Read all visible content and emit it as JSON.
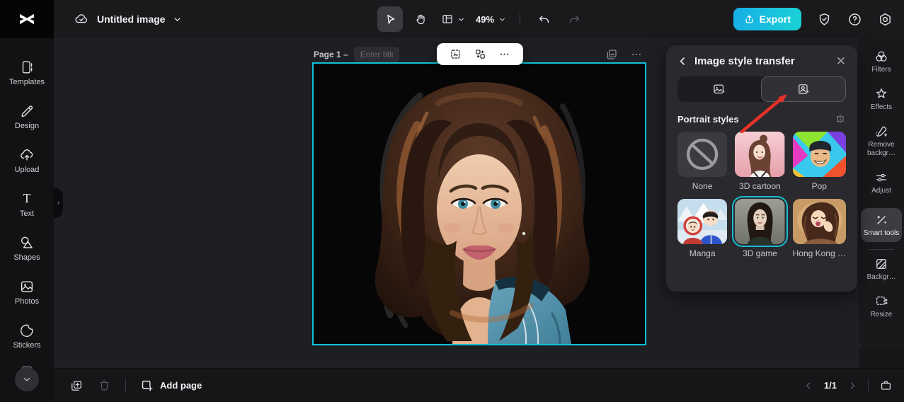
{
  "colors": {
    "accent_cyan": "#10c1d5",
    "export_gradient_from": "#18aee8",
    "export_gradient_to": "#1ad2d4",
    "selection_border": "#17c0d4",
    "annotation_arrow": "#e63229",
    "panel_bg": "#29292e",
    "topbar_bg": "#1a1a1d"
  },
  "topbar": {
    "title": "Untitled image",
    "zoom_level": "49%",
    "export_label": "Export"
  },
  "sidebar": {
    "items": [
      {
        "label": "Templates"
      },
      {
        "label": "Design"
      },
      {
        "label": "Upload"
      },
      {
        "label": "Text"
      },
      {
        "label": "Shapes"
      },
      {
        "label": "Photos"
      },
      {
        "label": "Stickers"
      }
    ]
  },
  "canvas": {
    "page_label": "Page 1 –",
    "title_placeholder": "Enter title"
  },
  "style_panel": {
    "title": "Image style transfer",
    "section_title": "Portrait styles",
    "styles": [
      {
        "label": "None",
        "selected": false
      },
      {
        "label": "3D cartoon",
        "selected": false
      },
      {
        "label": "Pop",
        "selected": false
      },
      {
        "label": "Manga",
        "selected": false
      },
      {
        "label": "3D game",
        "selected": true
      },
      {
        "label": "Hong Kong …",
        "selected": false
      }
    ]
  },
  "right_rail": {
    "items": [
      {
        "label": "Filters",
        "selected": false
      },
      {
        "label": "Effects",
        "selected": false
      },
      {
        "label": "Remove backgr…",
        "selected": false
      },
      {
        "label": "Adjust",
        "selected": false
      },
      {
        "label": "Smart tools",
        "selected": true
      },
      {
        "label": "Backgr…",
        "selected": false
      },
      {
        "label": "Resize",
        "selected": false
      }
    ]
  },
  "bottombar": {
    "add_page_label": "Add page",
    "page_indicator": "1/1"
  }
}
